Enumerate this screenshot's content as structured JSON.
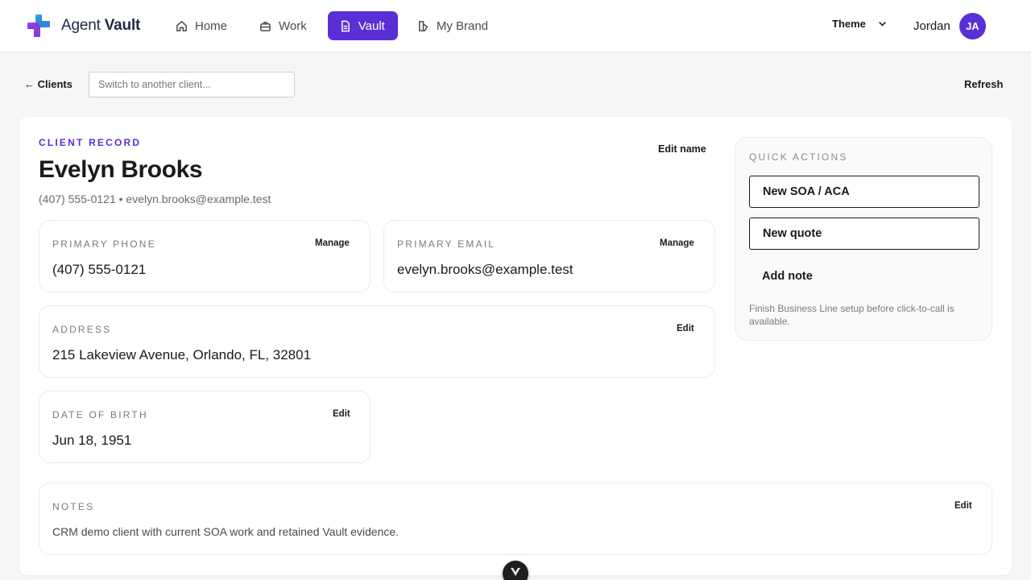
{
  "brand": {
    "name_light": "Agent",
    "name_bold": "Vault"
  },
  "nav": [
    {
      "label": "Home",
      "icon": "home-icon"
    },
    {
      "label": "Work",
      "icon": "briefcase-icon"
    },
    {
      "label": "Vault",
      "icon": "document-icon",
      "active": true
    },
    {
      "label": "My Brand",
      "icon": "brand-icon"
    }
  ],
  "header": {
    "theme_label": "Theme",
    "user_name": "Jordan",
    "user_initials": "JA"
  },
  "subbar": {
    "back_label": "← Clients",
    "switch_placeholder": "Switch to another client...",
    "refresh_label": "Refresh"
  },
  "client": {
    "eyebrow": "CLIENT RECORD",
    "name": "Evelyn Brooks",
    "subline": "(407) 555-0121 • evelyn.brooks@example.test",
    "edit_name_label": "Edit name"
  },
  "fields": {
    "phone": {
      "label": "PRIMARY PHONE",
      "value": "(407) 555-0121",
      "action": "Manage"
    },
    "email": {
      "label": "PRIMARY EMAIL",
      "value": "evelyn.brooks@example.test",
      "action": "Manage"
    },
    "address": {
      "label": "ADDRESS",
      "value": "215 Lakeview Avenue, Orlando, FL, 32801",
      "action": "Edit"
    },
    "dob": {
      "label": "DATE OF BIRTH",
      "value": "Jun 18, 1951",
      "action": "Edit"
    },
    "notes": {
      "label": "NOTES",
      "value": "CRM demo client with current SOA work and retained Vault evidence.",
      "action": "Edit"
    }
  },
  "quick_actions": {
    "title": "QUICK ACTIONS",
    "primary": [
      "New SOA / ACA",
      "New quote"
    ],
    "secondary": "Add note",
    "note": "Finish Business Line setup before click-to-call is available."
  },
  "colors": {
    "accent": "#5b2fd6",
    "logo_blue": "#2e7bd8",
    "logo_purple": "#8b3fd9"
  }
}
